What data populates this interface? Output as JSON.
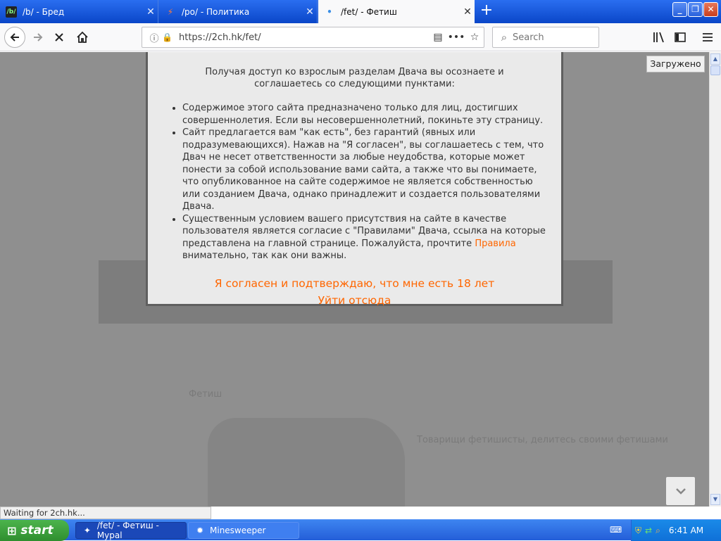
{
  "tabs": [
    {
      "icon": "/b/",
      "title": "/b/ - Бред",
      "active": false
    },
    {
      "icon": "⚡",
      "title": "/po/ - Политика",
      "active": false
    },
    {
      "icon": "•",
      "title": "/fet/ - Фетиш",
      "active": true
    }
  ],
  "nav": {
    "url": "https://2ch.hk/fet/",
    "search_placeholder": "Search"
  },
  "tooltip": "Загружено",
  "modal": {
    "intro": "Получая доступ ко взрослым разделам Двача вы осознаете и соглашаетесь со следующими пунктами:",
    "items": [
      "Содержимое этого сайта предназначено только для лиц, достигших совершеннолетия. Если вы несовершеннолетний, покиньте эту страницу.",
      "Сайт предлагается вам \"как есть\", без гарантий (явных или подразумевающихся). Нажав на \"Я согласен\", вы соглашаетесь с тем, что Двач не несет ответственности за любые неудобства, которые может понести за собой использование вами сайта, а также что вы понимаете, что опубликованное на сайте содержимое не является собственностью или созданием Двача, однако принадлежит и создается пользователями Двача."
    ],
    "item3_before": "Существенным условием вашего присутствия на сайте в качестве пользователя является согласие с \"Правилами\" Двача, ссылка на которые представлена на главной странице. Пожалуйста, прочтите ",
    "item3_link": "Правила",
    "item3_after": " внимательно, так как они важны.",
    "agree": "Я согласен и подтверждаю, что мне есть 18 лет",
    "leave": "Уйти отсюда"
  },
  "background_text": {
    "section_title": "Фетиш",
    "thread_title": "Товарищи фетишисты, делитесь своими фетишами"
  },
  "status": "Waiting for 2ch.hk...",
  "taskbar": {
    "start": "start",
    "items": [
      "/fet/ - Фетиш - Mypal",
      "Minesweeper"
    ],
    "time": "6:41 AM"
  }
}
